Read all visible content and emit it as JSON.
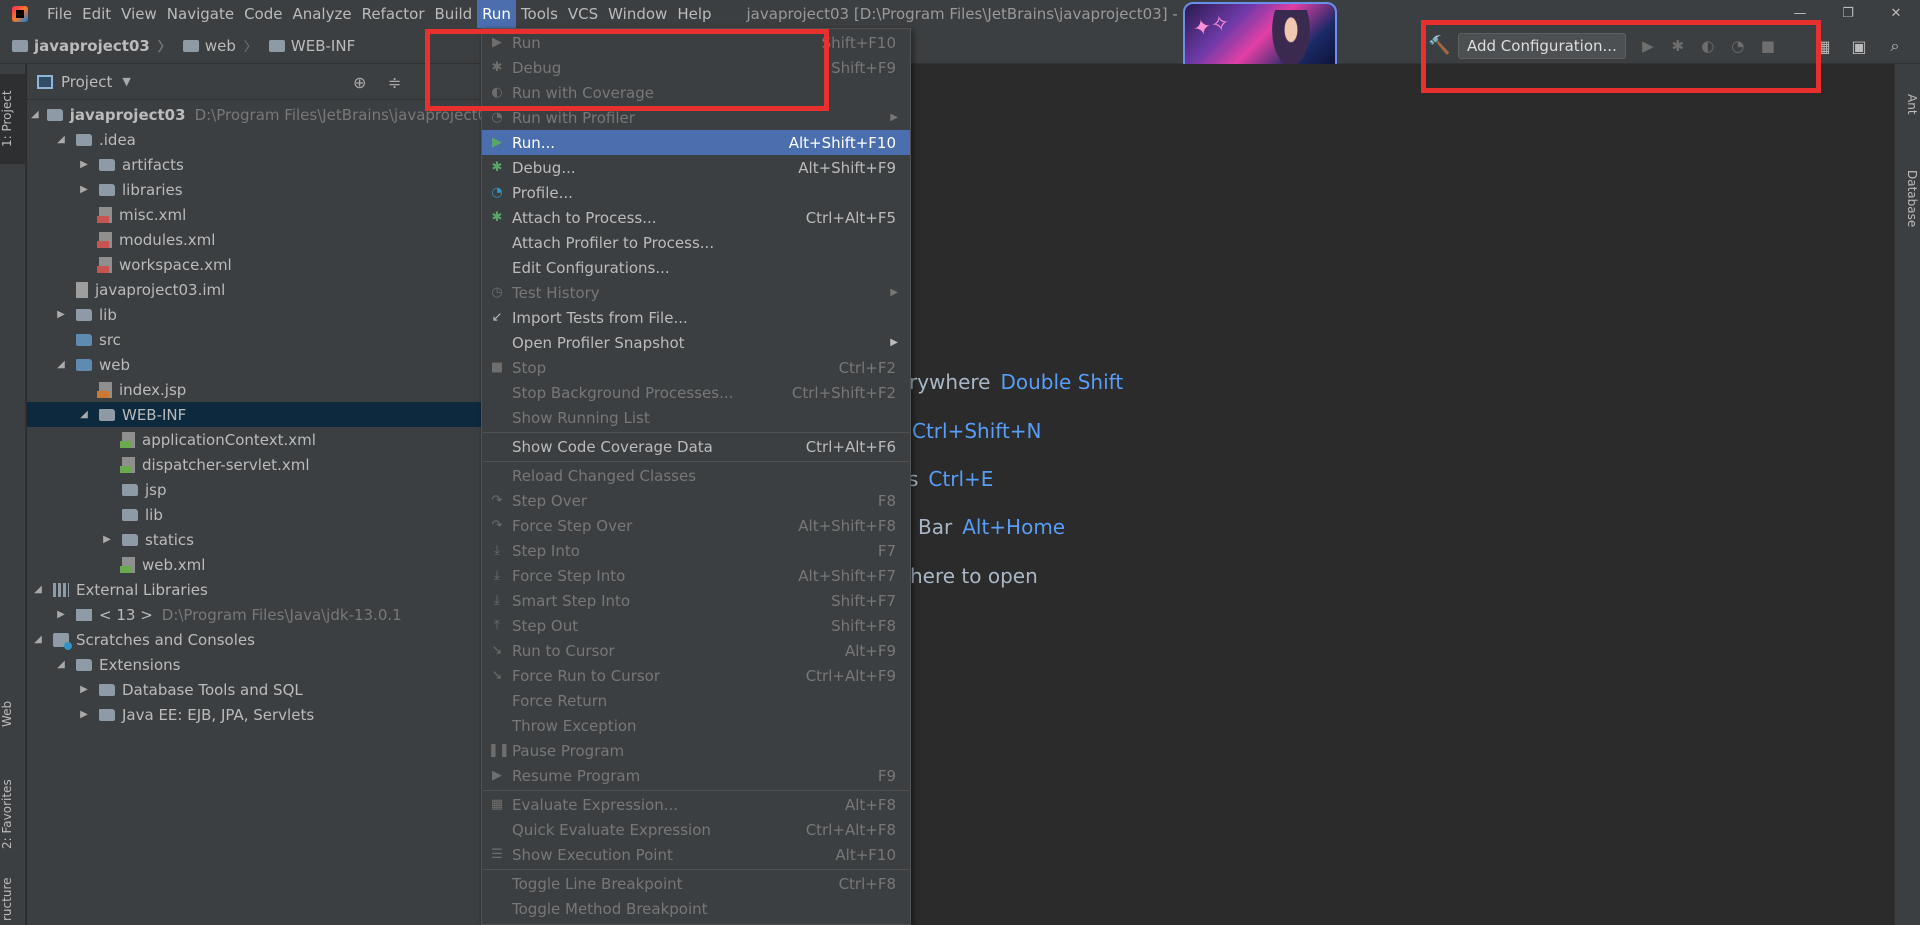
{
  "menubar": {
    "items": [
      "File",
      "Edit",
      "View",
      "Navigate",
      "Code",
      "Analyze",
      "Refactor",
      "Build",
      "Run",
      "Tools",
      "VCS",
      "Window",
      "Help"
    ],
    "window_title": "javaproject03 [D:\\Program Files\\JetBrains\\javaproject03] - Inte",
    "controls": [
      "—",
      "❐",
      "✕"
    ]
  },
  "navbar": {
    "crumbs": [
      "javaproject03",
      "web",
      "WEB-INF"
    ]
  },
  "toolbar": {
    "add_config_label": "Add Configuration..."
  },
  "left_stripe": {
    "project_tab": "1: Project",
    "web_tab": "Web",
    "favorites_tab": "2: Favorites",
    "structure_tab": "ructure"
  },
  "right_stripe": {
    "ant_tab": "Ant",
    "database_tab": "Database"
  },
  "project_panel": {
    "title": "Project",
    "tree": [
      {
        "label": "javaproject03",
        "path": "D:\\Program Files\\JetBrains\\javaproject03"
      },
      {
        "label": ".idea"
      },
      {
        "label": "artifacts"
      },
      {
        "label": "libraries"
      },
      {
        "label": "misc.xml"
      },
      {
        "label": "modules.xml"
      },
      {
        "label": "workspace.xml"
      },
      {
        "label": "javaproject03.iml"
      },
      {
        "label": "lib"
      },
      {
        "label": "src"
      },
      {
        "label": "web"
      },
      {
        "label": "index.jsp"
      },
      {
        "label": "WEB-INF"
      },
      {
        "label": "applicationContext.xml"
      },
      {
        "label": "dispatcher-servlet.xml"
      },
      {
        "label": "jsp"
      },
      {
        "label": "lib"
      },
      {
        "label": "statics"
      },
      {
        "label": "web.xml"
      },
      {
        "label": "External Libraries"
      },
      {
        "label": "< 13 >",
        "path": "D:\\Program Files\\Java\\jdk-13.0.1"
      },
      {
        "label": "Scratches and Consoles"
      },
      {
        "label": "Extensions"
      },
      {
        "label": "Database Tools and SQL"
      },
      {
        "label": "Java EE: EJB, JPA, Servlets"
      }
    ]
  },
  "editor": {
    "hints": [
      {
        "text": "rywhere",
        "key": "Double Shift"
      },
      {
        "text": "",
        "key": "Ctrl+Shift+N"
      },
      {
        "text": "s",
        "key": "Ctrl+E"
      },
      {
        "text": "Bar",
        "key": "Alt+Home"
      },
      {
        "text": "here to open",
        "key": ""
      }
    ]
  },
  "run_menu": {
    "items": [
      {
        "label": "Run",
        "shortcut": "Shift+F10"
      },
      {
        "label": "Debug",
        "shortcut": "Shift+F9"
      },
      {
        "label": "Run with Coverage",
        "shortcut": ""
      },
      {
        "label": "Run with Profiler",
        "shortcut": ""
      },
      {
        "label": "Run...",
        "shortcut": "Alt+Shift+F10"
      },
      {
        "label": "Debug...",
        "shortcut": "Alt+Shift+F9"
      },
      {
        "label": "Profile...",
        "shortcut": ""
      },
      {
        "label": "Attach to Process...",
        "shortcut": "Ctrl+Alt+F5"
      },
      {
        "label": "Attach Profiler to Process...",
        "shortcut": ""
      },
      {
        "label": "Edit Configurations...",
        "shortcut": ""
      },
      {
        "label": "Test History",
        "shortcut": ""
      },
      {
        "label": "Import Tests from File...",
        "shortcut": ""
      },
      {
        "label": "Open Profiler Snapshot",
        "shortcut": ""
      },
      {
        "label": "Stop",
        "shortcut": "Ctrl+F2"
      },
      {
        "label": "Stop Background Processes...",
        "shortcut": "Ctrl+Shift+F2"
      },
      {
        "label": "Show Running List",
        "shortcut": ""
      },
      {
        "label": "Show Code Coverage Data",
        "shortcut": "Ctrl+Alt+F6"
      },
      {
        "label": "Reload Changed Classes",
        "shortcut": ""
      },
      {
        "label": "Step Over",
        "shortcut": "F8"
      },
      {
        "label": "Force Step Over",
        "shortcut": "Alt+Shift+F8"
      },
      {
        "label": "Step Into",
        "shortcut": "F7"
      },
      {
        "label": "Force Step Into",
        "shortcut": "Alt+Shift+F7"
      },
      {
        "label": "Smart Step Into",
        "shortcut": "Shift+F7"
      },
      {
        "label": "Step Out",
        "shortcut": "Shift+F8"
      },
      {
        "label": "Run to Cursor",
        "shortcut": "Alt+F9"
      },
      {
        "label": "Force Run to Cursor",
        "shortcut": "Ctrl+Alt+F9"
      },
      {
        "label": "Force Return",
        "shortcut": ""
      },
      {
        "label": "Throw Exception",
        "shortcut": ""
      },
      {
        "label": "Pause Program",
        "shortcut": ""
      },
      {
        "label": "Resume Program",
        "shortcut": "F9"
      },
      {
        "label": "Evaluate Expression...",
        "shortcut": "Alt+F8"
      },
      {
        "label": "Quick Evaluate Expression",
        "shortcut": "Ctrl+Alt+F8"
      },
      {
        "label": "Show Execution Point",
        "shortcut": "Alt+F10"
      },
      {
        "label": "Toggle Line Breakpoint",
        "shortcut": "Ctrl+F8"
      },
      {
        "label": "Toggle Method Breakpoint",
        "shortcut": ""
      }
    ]
  },
  "colors": {
    "highlight": "#4b6eaf",
    "annotation_red": "#e8302f",
    "link_blue": "#589df6",
    "selected_row": "#0d293e"
  }
}
